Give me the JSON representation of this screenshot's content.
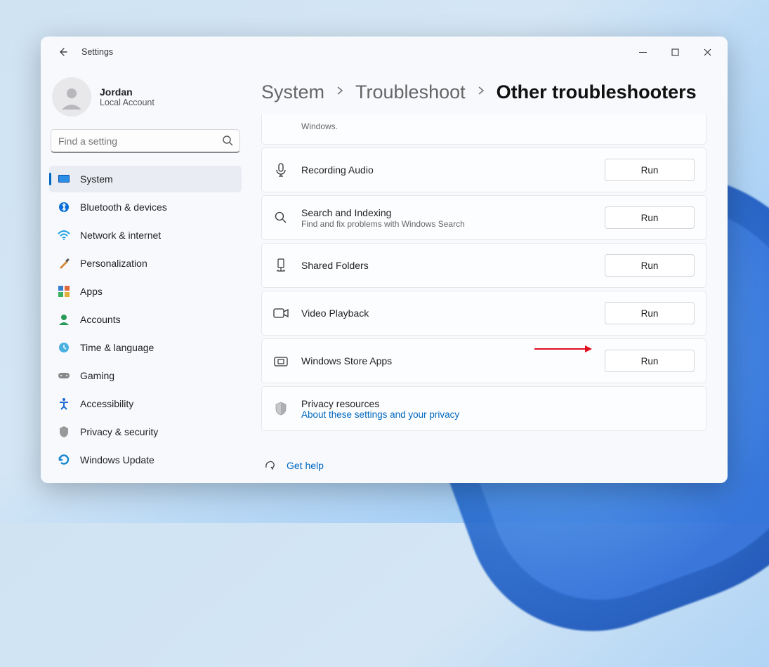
{
  "app": {
    "title": "Settings"
  },
  "profile": {
    "name": "Jordan",
    "sub": "Local Account"
  },
  "search": {
    "placeholder": "Find a setting"
  },
  "nav": [
    {
      "label": "System",
      "icon": "system",
      "active": true
    },
    {
      "label": "Bluetooth & devices",
      "icon": "bluetooth"
    },
    {
      "label": "Network & internet",
      "icon": "wifi"
    },
    {
      "label": "Personalization",
      "icon": "brush"
    },
    {
      "label": "Apps",
      "icon": "apps"
    },
    {
      "label": "Accounts",
      "icon": "person"
    },
    {
      "label": "Time & language",
      "icon": "clock"
    },
    {
      "label": "Gaming",
      "icon": "gamepad"
    },
    {
      "label": "Accessibility",
      "icon": "access"
    },
    {
      "label": "Privacy & security",
      "icon": "shield"
    },
    {
      "label": "Windows Update",
      "icon": "update"
    }
  ],
  "breadcrumb": [
    {
      "label": "System",
      "current": false
    },
    {
      "label": "Troubleshoot",
      "current": false
    },
    {
      "label": "Other troubleshooters",
      "current": true
    }
  ],
  "troubleshooters": {
    "partial_sub": "Windows.",
    "items": [
      {
        "title": "Recording Audio",
        "sub": "",
        "icon": "mic",
        "run": "Run"
      },
      {
        "title": "Search and Indexing",
        "sub": "Find and fix problems with Windows Search",
        "icon": "search",
        "run": "Run"
      },
      {
        "title": "Shared Folders",
        "sub": "",
        "icon": "share",
        "run": "Run"
      },
      {
        "title": "Video Playback",
        "sub": "",
        "icon": "video",
        "run": "Run"
      },
      {
        "title": "Windows Store Apps",
        "sub": "",
        "icon": "store",
        "run": "Run",
        "annotated": true
      }
    ],
    "privacy": {
      "title": "Privacy resources",
      "link": "About these settings and your privacy"
    }
  },
  "help": {
    "label": "Get help"
  }
}
